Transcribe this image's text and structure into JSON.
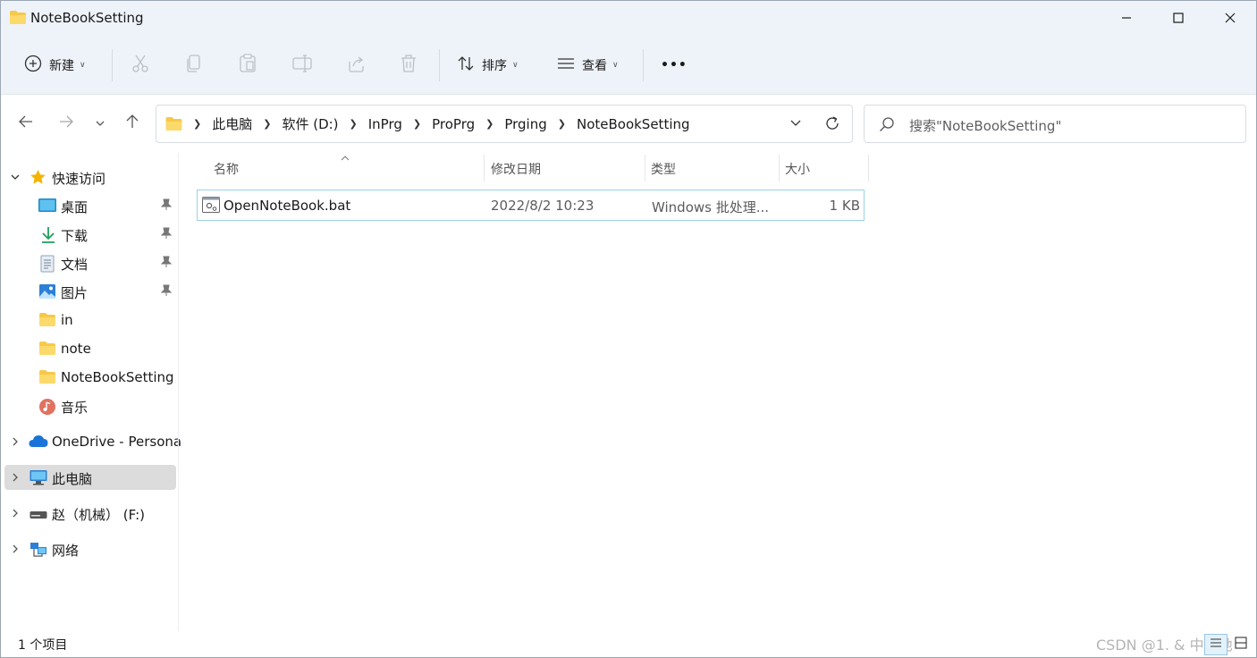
{
  "window": {
    "title": "NoteBookSetting"
  },
  "toolbar": {
    "new_label": "新建",
    "sort_label": "排序",
    "view_label": "查看",
    "more_label": "•••"
  },
  "address": {
    "crumbs": [
      "此电脑",
      "软件 (D:)",
      "InPrg",
      "ProPrg",
      "Prging",
      "NoteBookSetting"
    ]
  },
  "search": {
    "placeholder": "搜索\"NoteBookSetting\""
  },
  "nav": {
    "quick_access": "快速访问",
    "quick_items": [
      {
        "label": "桌面",
        "icon": "desktop-icon"
      },
      {
        "label": "下载",
        "icon": "download-icon"
      },
      {
        "label": "文档",
        "icon": "document-icon"
      },
      {
        "label": "图片",
        "icon": "pictures-icon"
      },
      {
        "label": "in",
        "icon": "folder-icon"
      },
      {
        "label": "note",
        "icon": "folder-icon"
      },
      {
        "label": "NoteBookSetting",
        "icon": "folder-icon"
      },
      {
        "label": "音乐",
        "icon": "music-icon"
      }
    ],
    "onedrive": "OneDrive - Persona",
    "this_pc": "此电脑",
    "drive_f": "赵（机械） (F:)",
    "network": "网络"
  },
  "columns": {
    "name": "名称",
    "modified": "修改日期",
    "type": "类型",
    "size": "大小"
  },
  "files": [
    {
      "name": "OpenNoteBook.bat",
      "modified": "2022/8/2 10:23",
      "type": "Windows 批处理...",
      "size": "1 KB"
    }
  ],
  "status": {
    "count": "1 个项目"
  },
  "watermark": "CSDN @1. & 中华她",
  "colors": {
    "chrome_bg": "#eef3f9",
    "selected_row_border": "#99d1e6",
    "folder_yellow": "#f7c948",
    "star_yellow": "#f4b400"
  }
}
